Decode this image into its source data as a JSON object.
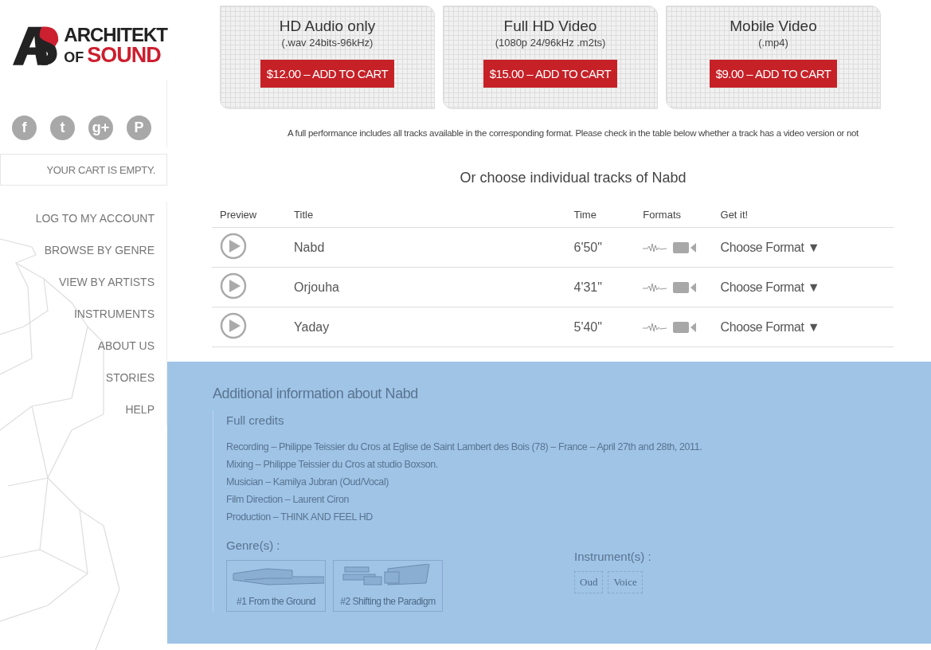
{
  "logo": {
    "line1": "ARCHITEKT",
    "line2a": "OF",
    "line2b": "SOUND"
  },
  "social": [
    {
      "glyph": "f"
    },
    {
      "glyph": "t"
    },
    {
      "glyph": "g+"
    },
    {
      "glyph": "P"
    }
  ],
  "cart": {
    "text": "YOUR CART IS EMPTY."
  },
  "nav": [
    "LOG TO MY ACCOUNT",
    "BROWSE BY GENRE",
    "VIEW BY ARTISTS",
    "INSTRUMENTS",
    "ABOUT US",
    "STORIES",
    "HELP"
  ],
  "offers": [
    {
      "title": "HD Audio only",
      "format": "(.wav 24bits-96kHz)",
      "button": "$12.00 – ADD TO CART"
    },
    {
      "title": "Full HD Video",
      "format": "(1080p 24/96kHz .m2ts)",
      "button": "$15.00 – ADD TO CART"
    },
    {
      "title": "Mobile Video",
      "format": "(.mp4)",
      "button": "$9.00 – ADD TO CART"
    }
  ],
  "note": "A full performance includes all tracks available in the corresponding format. Please check in the table below whether a track has a video version or not",
  "tracks_heading": "Or choose individual tracks of Nabd",
  "table": {
    "columns": [
      "Preview",
      "Title",
      "Time",
      "Formats",
      "Get it!"
    ],
    "rows": [
      {
        "title": "Nabd",
        "time": "6'50\"",
        "choose": "Choose Format ▼"
      },
      {
        "title": "Orjouha",
        "time": "4'31\"",
        "choose": "Choose Format ▼"
      },
      {
        "title": "Yaday",
        "time": "5'40\"",
        "choose": "Choose Format ▼"
      }
    ]
  },
  "info": {
    "heading": "Additional information about Nabd",
    "credits_heading": "Full credits",
    "credits": [
      "Recording – Philippe Teissier du Cros at Eglise de Saint Lambert des Bois (78) – France – April 27th and 28th, 2011.",
      "Mixing – Philippe Teissier du Cros at studio Boxson.",
      "Musician – Kamilya Jubran (Oud/Vocal)",
      "Film Direction – Laurent Ciron",
      "Production – THINK AND FEEL HD"
    ],
    "genres_label": "Genre(s) :",
    "genres": [
      "#1 From the Ground",
      "#2 Shifting the Paradigm"
    ],
    "instruments_label": "Instrument(s) :",
    "instruments": [
      "Oud",
      "Voice"
    ]
  }
}
